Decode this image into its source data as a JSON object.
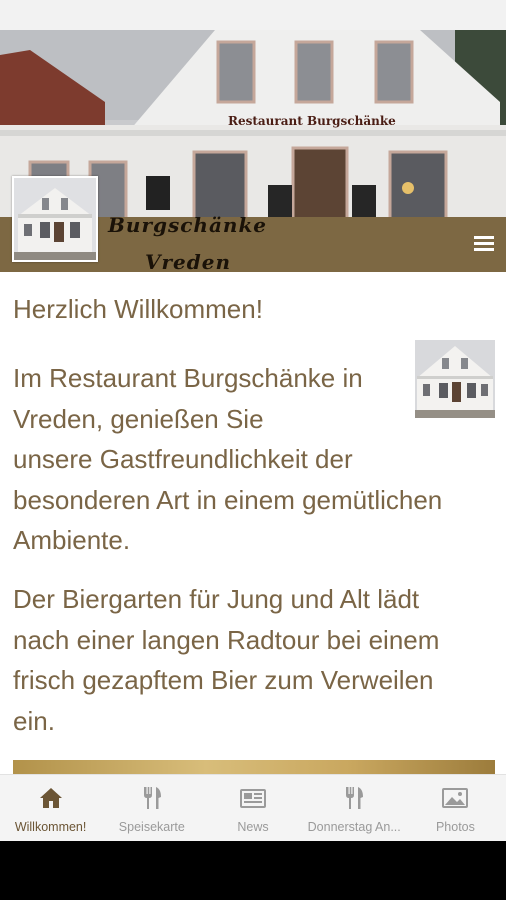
{
  "header": {
    "brand_line_1": "Burgschänke",
    "brand_line_2": "Vreden",
    "facade_sign": "Restaurant   Burgschänke",
    "menu_icon": "hamburger-menu-icon"
  },
  "content": {
    "title": "Herzlich Willkommen!",
    "paragraph_1": [
      "Im Restaurant Burgschänke in",
      "Vreden, genießen Sie",
      "unsere Gastfreundlichkeit der",
      "besonderen Art in einem gemütlichen",
      "Ambiente."
    ],
    "paragraph_2": [
      "Der Biergarten für Jung und Alt lädt",
      "nach einer langen Radtour bei einem",
      "frisch gezapftem Bier zum Verweilen",
      "ein."
    ]
  },
  "bottom_nav": {
    "items": [
      {
        "label": "Willkommen!",
        "icon": "home-icon",
        "active": true
      },
      {
        "label": "Speisekarte",
        "icon": "cutlery-icon",
        "active": false
      },
      {
        "label": "News",
        "icon": "newspaper-icon",
        "active": false
      },
      {
        "label": "Donnerstag An...",
        "icon": "cutlery-icon",
        "active": false
      },
      {
        "label": "Photos",
        "icon": "photo-icon",
        "active": false
      }
    ]
  },
  "colors": {
    "brand_brown": "#7d6843",
    "text_brown": "#7a6546",
    "nav_active": "#6b5535",
    "nav_inactive": "#9a9a9a"
  }
}
